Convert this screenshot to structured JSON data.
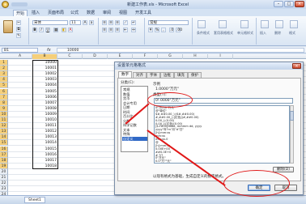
{
  "window": {
    "title": "新建工作表.xls - Microsoft Excel",
    "btn_min": "–",
    "btn_max": "□",
    "btn_close": "×"
  },
  "tabs": [
    "开始",
    "插入",
    "页面布局",
    "公式",
    "数据",
    "审阅",
    "视图",
    "开发工具"
  ],
  "ribbon": {
    "font_name": "宋体",
    "font_size": "11",
    "number_format": "常规",
    "bold": "B",
    "italic": "I",
    "underline": "U",
    "percent": "%",
    "comma": ",",
    "cond_format": "条件格式",
    "table_format": "套用表格格式",
    "cell_style": "单元格样式",
    "insert": "插入",
    "delete": "删除",
    "format": "格式"
  },
  "formula_bar": {
    "name_box": "B1",
    "fx": "fx",
    "value": "10000"
  },
  "sheet": {
    "columns": [
      "A",
      "B",
      "C",
      "D",
      "E",
      "F",
      "G",
      "H",
      "I"
    ],
    "rows": [
      "1",
      "2",
      "3",
      "4",
      "5",
      "6",
      "7",
      "8",
      "9",
      "10",
      "11",
      "12",
      "13",
      "14",
      "15",
      "16",
      "17",
      "18",
      "19",
      "20",
      "21",
      "22",
      "23",
      "24"
    ],
    "values": [
      "10000",
      "10001",
      "10002",
      "10003",
      "10004",
      "10005",
      "10006",
      "10007",
      "10008",
      "10009",
      "10010",
      "10011",
      "10012",
      "10013",
      "10014",
      "10015",
      "10016",
      "10017",
      "10018"
    ]
  },
  "dialog": {
    "title": "设置单元格格式",
    "close": "×",
    "tabs": [
      "数字",
      "对齐",
      "字体",
      "边框",
      "填充",
      "保护"
    ],
    "category_label": "分类(C):",
    "categories": [
      "常规",
      "数值",
      "货币",
      "会计专用",
      "日期",
      "时间",
      "百分比",
      "分数",
      "科学记数",
      "文本",
      "特殊",
      "自定义"
    ],
    "selected_category": "自定义",
    "sample_label": "示例",
    "sample_value": "1.0000\"万元\"",
    "type_label": "类型(T):",
    "type_value": "0!.0000\"万元\"",
    "type_list": [
      "0!.0000\"万元\"",
      "@\"单位\"",
      "$#,##0.00_);($#,##0.00)",
      "#,##0.00_);[红色](#,##0.00)",
      "0.00_);(0.00)",
      "0.00_);[红色](0.00)",
      "[$-F800]dddd, mmmm dd, yyyy",
      "yyyy\"年\"m\"月\"d\"日\"",
      "[h]:mm:ss",
      "mm:ss",
      "mm:ss.0",
      "@",
      "[h]:mm:ss",
      "0.00E+00",
      "##0.0E+0",
      "# ?/?",
      "0\"万元\"",
      "0.0\"万\"\"元\""
    ],
    "delete_button": "删除(D)",
    "description": "以现有格式为基础，生成自定义的数字格式。",
    "ok_button": "确定",
    "cancel_button": "取消"
  },
  "sheet_tabs": [
    "Sheet1"
  ],
  "colors": {
    "annotation": "#e01818",
    "selection": "#3169c6",
    "ribbon": "#dce6f2"
  }
}
